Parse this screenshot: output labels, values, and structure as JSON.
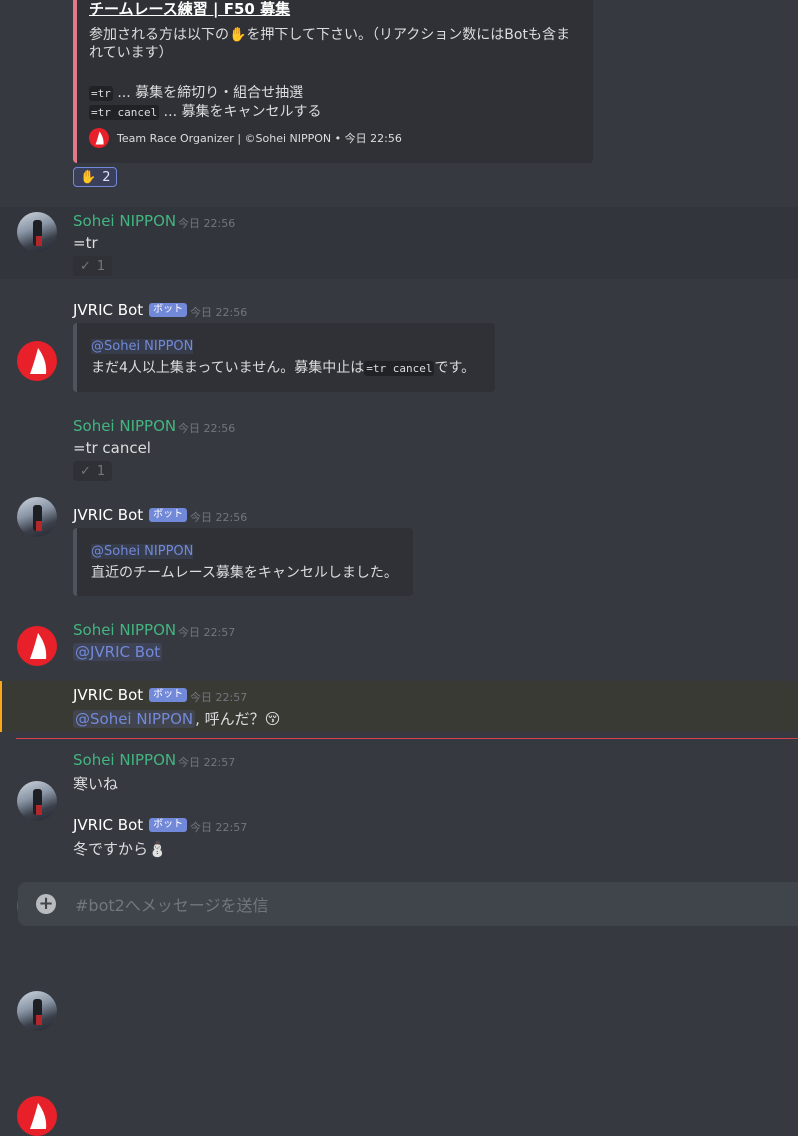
{
  "embed": {
    "title": "チームレース練習 | F50 募集",
    "description": "参加される方は以下の✋を押下して下さい。（リアクション数にはBotも含まれています）",
    "cmd1_code": "=tr",
    "cmd1_text": " ... 募集を締切り・組合せ抽選",
    "cmd2_code": "=tr cancel",
    "cmd2_text": " ... 募集をキャンセルする",
    "footer": "Team Race Organizer | ©Sohei NIPPON • 今日 22:56",
    "reaction_emoji": "✋",
    "reaction_count": "2"
  },
  "messages": [
    {
      "author": "Sohei NIPPON",
      "time": "今日 22:56",
      "text": "=tr",
      "reaction_emoji": "✓",
      "reaction_count": "1"
    },
    {
      "author": "JVRIC Bot",
      "tag": "ボット",
      "time": "今日 22:56",
      "quote_mention": "@Sohei NIPPON",
      "quote_text_before": "まだ4人以上集まっていません。募集中止は",
      "quote_code": "=tr cancel",
      "quote_text_after": "です。"
    },
    {
      "author": "Sohei NIPPON",
      "time": "今日 22:56",
      "text": "=tr cancel",
      "reaction_emoji": "✓",
      "reaction_count": "1"
    },
    {
      "author": "JVRIC Bot",
      "tag": "ボット",
      "time": "今日 22:56",
      "quote_mention": "@Sohei NIPPON",
      "quote_text": "直近のチームレース募集をキャンセルしました。"
    },
    {
      "author": "Sohei NIPPON",
      "time": "今日 22:57",
      "mention": "@JVRIC Bot"
    },
    {
      "author": "JVRIC Bot",
      "tag": "ボット",
      "time": "今日 22:57",
      "mention": "@Sohei NIPPON",
      "text": ", 呼んだ？",
      "emoji": "😚"
    },
    {
      "author": "Sohei NIPPON",
      "time": "今日 22:57",
      "text": "寒いね"
    },
    {
      "author": "JVRIC Bot",
      "tag": "ボット",
      "time": "今日 22:57",
      "text": "冬ですから",
      "emoji": "⛄"
    }
  ],
  "composer": {
    "placeholder": "#bot2へメッセージを送信"
  },
  "colors": {
    "background": "#36393f",
    "embed_bar": "#e07a8a",
    "user_name": "#43b581",
    "bot_tag": "#7289da",
    "mention_highlight": "#faa61a",
    "new_divider": "#d84150"
  },
  "icons": {
    "bot_avatar": "red-sail-logo",
    "user_avatar": "photo-avatar",
    "composer": "plus-circle-icon"
  }
}
